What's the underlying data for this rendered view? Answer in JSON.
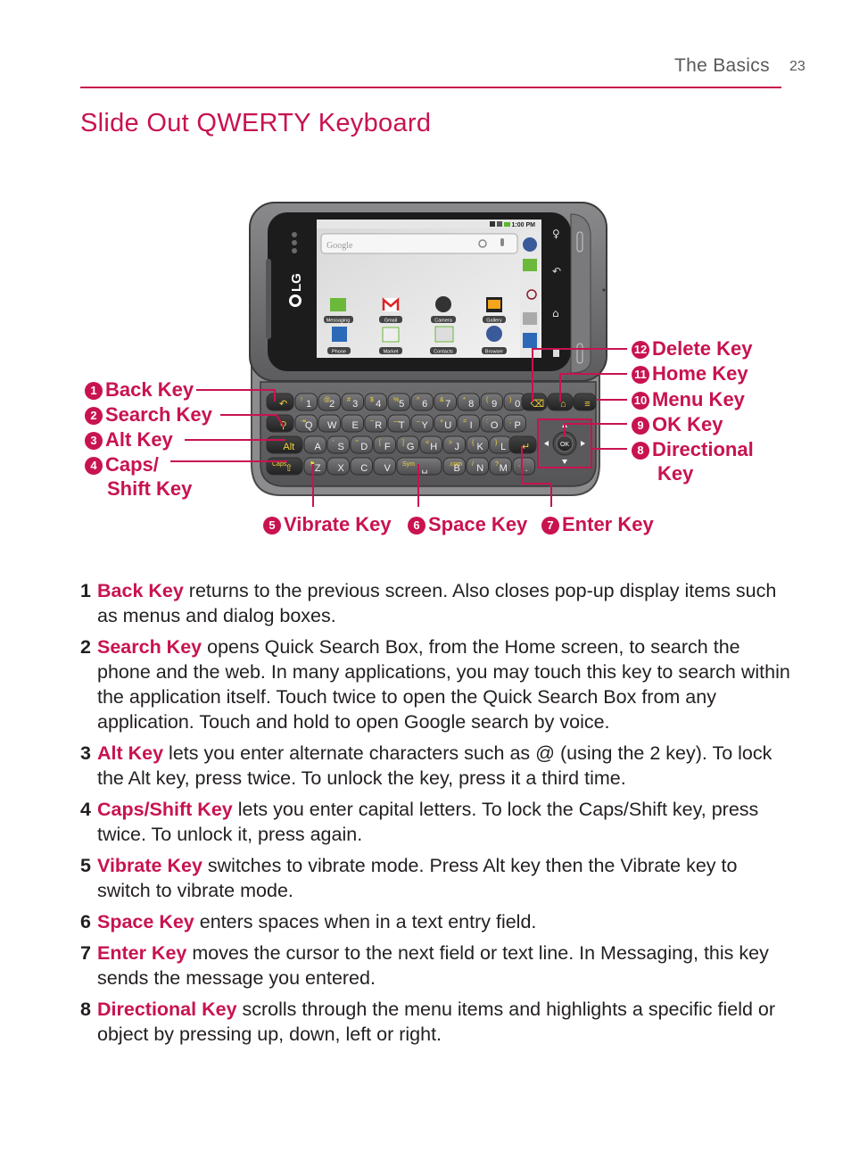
{
  "header": {
    "section": "The Basics",
    "page_number": "23"
  },
  "title": "Slide Out QWERTY Keyboard",
  "brand_color": "#c8134f",
  "figure": {
    "callouts_left": [
      {
        "num": "1",
        "label": "Back Key"
      },
      {
        "num": "2",
        "label": "Search Key"
      },
      {
        "num": "3",
        "label": "Alt Key"
      },
      {
        "num": "4",
        "label": "Caps/",
        "label2": "Shift Key"
      }
    ],
    "callouts_bottom": [
      {
        "num": "5",
        "label": "Vibrate Key"
      },
      {
        "num": "6",
        "label": "Space Key"
      },
      {
        "num": "7",
        "label": "Enter Key"
      }
    ],
    "callouts_right": [
      {
        "num": "12",
        "label": "Delete Key"
      },
      {
        "num": "11",
        "label": "Home Key"
      },
      {
        "num": "10",
        "label": "Menu Key"
      },
      {
        "num": "9",
        "label": "OK Key"
      },
      {
        "num": "8",
        "label": "Directional",
        "label2": "Key"
      }
    ],
    "phone": {
      "brand": "LG",
      "status_time": "1:00 PM",
      "search_placeholder": "Google",
      "apps_row1": [
        "Messaging",
        "Gmail",
        "Camera",
        "Gallery"
      ],
      "apps_row2": [
        "Phone",
        "Market",
        "Contacts",
        "Browser"
      ],
      "keyboard": {
        "row1": [
          [
            "!",
            "1"
          ],
          [
            "@",
            "2"
          ],
          [
            "#",
            "3"
          ],
          [
            "$",
            "4"
          ],
          [
            "%",
            "5"
          ],
          [
            "^",
            "6"
          ],
          [
            "&",
            "7"
          ],
          [
            "*",
            "8"
          ],
          [
            "(",
            "9"
          ],
          [
            ")",
            "0"
          ]
        ],
        "row2": [
          [
            "⇥",
            "Q"
          ],
          [
            "",
            "W"
          ],
          [
            "",
            "E"
          ],
          [
            "~",
            "R"
          ],
          [
            "—",
            "T"
          ],
          [
            "–",
            "Y"
          ],
          [
            "+",
            "U"
          ],
          [
            "=",
            "I"
          ],
          [
            ":",
            "O"
          ],
          [
            ";",
            "P"
          ]
        ],
        "row3": [
          [
            "",
            "A"
          ],
          [
            "'",
            "S"
          ],
          [
            "\"",
            "D"
          ],
          [
            "[",
            "F"
          ],
          [
            "]",
            "G"
          ],
          [
            "<",
            "H"
          ],
          [
            ">",
            "J"
          ],
          [
            "{",
            "K"
          ],
          [
            "}",
            "L"
          ]
        ],
        "row4": [
          [
            "⚑",
            "Z"
          ],
          [
            "",
            "X"
          ],
          [
            "",
            "C"
          ],
          [
            "",
            "V"
          ]
        ],
        "row4b": [
          [
            ".com",
            "B"
          ],
          [
            "/",
            "N"
          ],
          [
            "?",
            "M"
          ],
          [
            ",",
            "."
          ]
        ],
        "alt_label": "Alt",
        "caps_label": "Caps",
        "sym_label": "Sym",
        "ok_label": "OK"
      }
    }
  },
  "items": [
    {
      "num": "1",
      "key": "Back Key",
      "text": " returns to the previous screen. Also closes pop-up display items such as menus and dialog boxes."
    },
    {
      "num": "2",
      "key": "Search Key",
      "text": " opens Quick Search Box, from the Home screen, to search the phone and the web. In many applications, you may touch this key to search within the application itself. Touch twice to open the Quick Search Box from any application. Touch and hold to open Google search by voice."
    },
    {
      "num": "3",
      "key": "Alt Key",
      "text": " lets you enter alternate characters such as @ (using the 2 key). To lock the Alt key, press twice. To unlock the key, press it a third time."
    },
    {
      "num": "4",
      "key": "Caps/Shift Key",
      "text": " lets you enter capital letters. To lock the Caps/Shift key, press twice. To unlock it, press again."
    },
    {
      "num": "5",
      "key": "Vibrate Key",
      "text": " switches to vibrate mode. Press Alt key then the Vibrate key to switch to vibrate mode."
    },
    {
      "num": "6",
      "key": "Space Key",
      "text": " enters spaces when in a text entry field."
    },
    {
      "num": "7",
      "key": "Enter Key",
      "text": " moves the cursor to the next field or text line. In Messaging, this key sends the message you entered."
    },
    {
      "num": "8",
      "key": "Directional Key",
      "text": " scrolls through the menu items and highlights a specific field or object by pressing up, down, left or right."
    }
  ]
}
